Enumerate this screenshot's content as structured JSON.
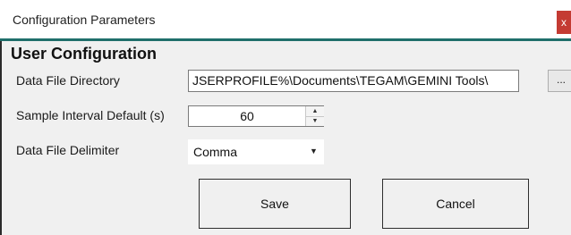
{
  "window": {
    "title": "Configuration Parameters",
    "close_label": "x"
  },
  "section": {
    "title": "User Configuration"
  },
  "fields": {
    "data_dir": {
      "label": "Data File Directory",
      "value": "JSERPROFILE%\\Documents\\TEGAM\\GEMINI Tools\\"
    },
    "browse_label": "...",
    "sample_interval": {
      "label": "Sample Interval Default (s)",
      "value": "60"
    },
    "delimiter": {
      "label": "Data File Delimiter",
      "value": "Comma"
    }
  },
  "buttons": {
    "save": "Save",
    "cancel": "Cancel"
  },
  "colors": {
    "accent_rule": "#1f6f6b",
    "close_button": "#c43b33",
    "panel_background": "#f0f0f0"
  },
  "icons": {
    "spin_up": "chevron-up-icon",
    "spin_down": "chevron-down-icon",
    "dropdown": "dropdown-arrow-icon"
  }
}
